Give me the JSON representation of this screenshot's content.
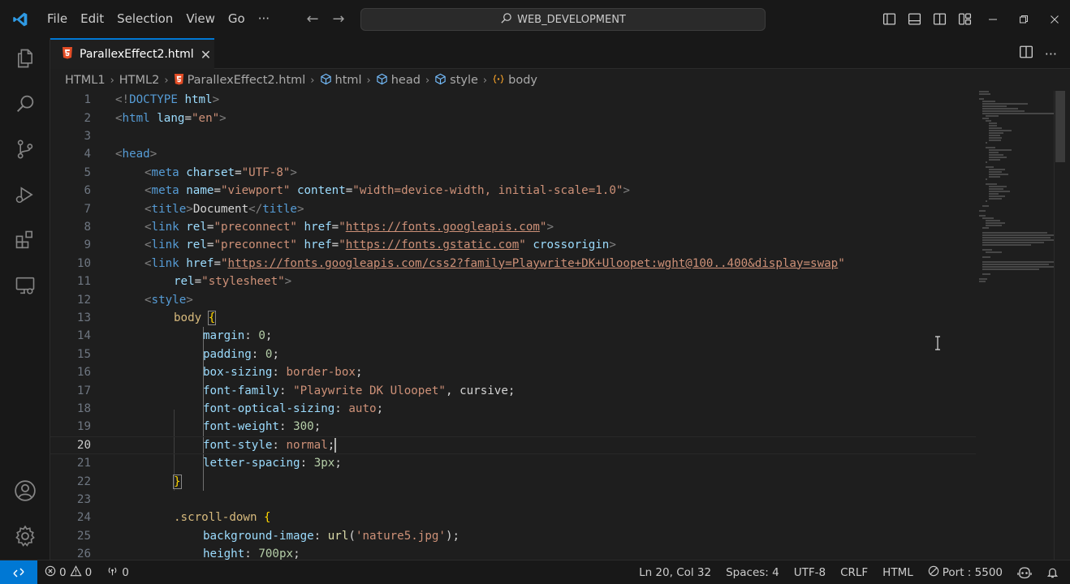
{
  "titlebar": {
    "menu": [
      "File",
      "Edit",
      "Selection",
      "View",
      "Go",
      "···"
    ],
    "search": "WEB_DEVELOPMENT"
  },
  "tab": {
    "label": "ParallexEffect2.html"
  },
  "breadcrumb": [
    "HTML1",
    "HTML2",
    "ParallexEffect2.html",
    "html",
    "head",
    "style",
    "body"
  ],
  "editor": {
    "current_line": 20,
    "lines": [
      {
        "n": "1"
      },
      {
        "n": "2"
      },
      {
        "n": "3"
      },
      {
        "n": "4"
      },
      {
        "n": "5"
      },
      {
        "n": "6"
      },
      {
        "n": "7"
      },
      {
        "n": "8"
      },
      {
        "n": "9"
      },
      {
        "n": "10"
      },
      {
        "n": "11"
      },
      {
        "n": "12"
      },
      {
        "n": "13"
      },
      {
        "n": "14"
      },
      {
        "n": "15"
      },
      {
        "n": "16"
      },
      {
        "n": "17"
      },
      {
        "n": "18"
      },
      {
        "n": "19"
      },
      {
        "n": "20"
      },
      {
        "n": "21"
      },
      {
        "n": "22"
      },
      {
        "n": "23"
      },
      {
        "n": "24"
      },
      {
        "n": "25"
      },
      {
        "n": "26"
      }
    ],
    "tokens": {
      "doctype_open": "<!",
      "doctype": "DOCTYPE",
      "html": "html",
      "gt": ">",
      "lt": "<",
      "lang": "lang",
      "eq": "=",
      "en": "\"en\"",
      "head": "head",
      "meta": "meta",
      "charset": "charset",
      "utf8": "\"UTF-8\"",
      "name": "name",
      "viewport": "\"viewport\"",
      "content": "content",
      "viewport_content": "\"width=device-width, initial-scale=1.0\"",
      "title": "title",
      "doc_text": "Document",
      "close_lt": "</",
      "link": "link",
      "rel": "rel",
      "preconnect": "\"preconnect\"",
      "href": "href",
      "q": "\"",
      "url1": "https://fonts.googleapis.com",
      "url2": "https://fonts.gstatic.com",
      "crossorigin": "crossorigin",
      "url3": "https://fonts.googleapis.com/css2?family=Playwrite+DK+Uloopet:wght@100..400&display=swap",
      "stylesheet": "\"stylesheet\"",
      "style": "style",
      "body_sel": "body",
      "brace_open": "{",
      "brace_close": "}",
      "colon": ": ",
      "semi": ";",
      "comma": ", ",
      "margin": "margin",
      "padding": "padding",
      "box_sizing": "box-sizing",
      "border_box": "border-box",
      "font_family": "font-family",
      "playwrite": "\"Playwrite DK Uloopet\"",
      "cursive": "cursive",
      "font_optical": "font-optical-sizing",
      "auto": "auto",
      "font_weight": "font-weight",
      "w300": "300",
      "font_style": "font-style",
      "normal": "normal",
      "letter_spacing": "letter-spacing",
      "px3": "3px",
      "zero": "0",
      "scroll_down": ".scroll-down",
      "bg_image": "background-image",
      "url_fn": "url",
      "paren_open": "(",
      "paren_close": ")",
      "nature": "'nature5.jpg'",
      "height": "height",
      "px700": "700px"
    }
  },
  "statusbar": {
    "errors": "0",
    "warnings": "0",
    "ports": "0",
    "position": "Ln 20, Col 32",
    "spaces": "Spaces: 4",
    "encoding": "UTF-8",
    "eol": "CRLF",
    "language": "HTML",
    "port": "Port : 5500"
  }
}
